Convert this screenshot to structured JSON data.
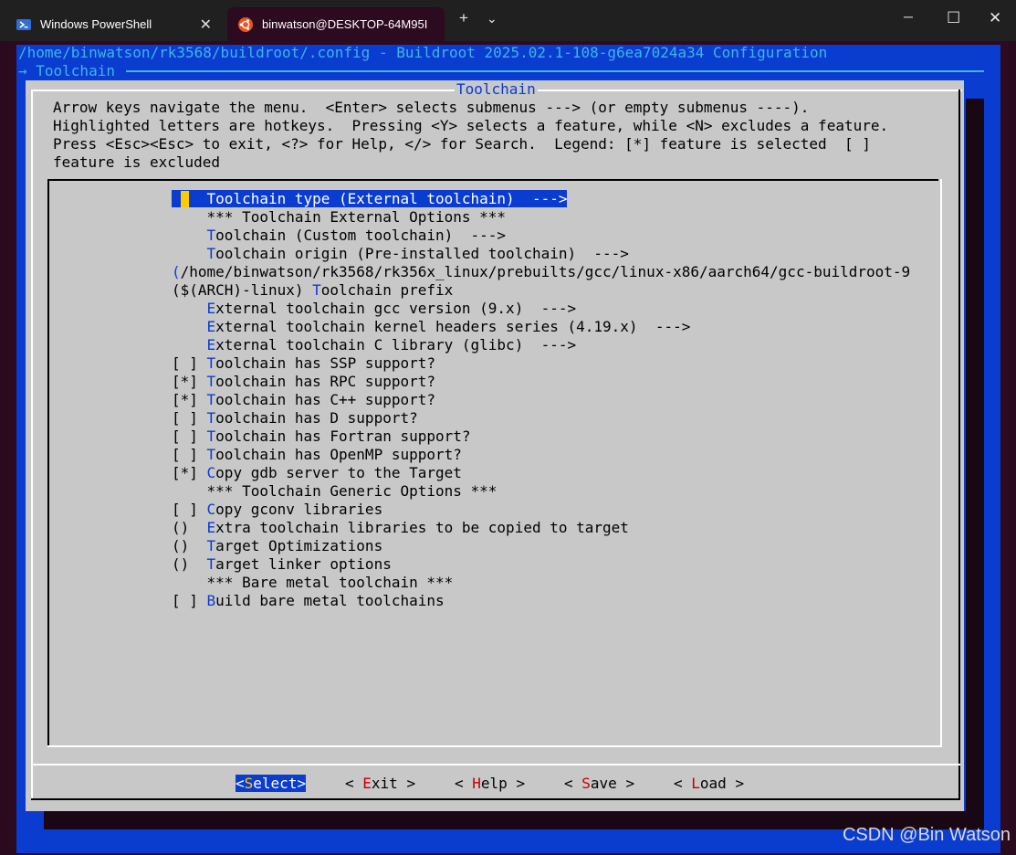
{
  "tabs": [
    {
      "label": "Windows PowerShell",
      "icon": "powershell-icon",
      "active": false
    },
    {
      "label": "binwatson@DESKTOP-64M95I",
      "icon": "ubuntu-icon",
      "active": true
    }
  ],
  "titlebar": {
    "new_tab": "+",
    "dropdown": "⌄",
    "minimize": "─",
    "maximize": "☐",
    "close": "✕",
    "tab_close": "✕"
  },
  "terminal": {
    "header": "/home/binwatson/rk3568/buildroot/.config - Buildroot 2025.02.1-108-g6ea7024a34 Configuration",
    "breadcrumb": "→ Toolchain ",
    "dialog_title": "Toolchain",
    "help_lines": [
      "Arrow keys navigate the menu.  <Enter> selects submenus ---> (or empty submenus ----).",
      "Highlighted letters are hotkeys.  Pressing <Y> selects a feature, while <N> excludes a feature.",
      "Press <Esc><Esc> to exit, <?> for Help, </> for Search.  Legend: [*] feature is selected  [ ]",
      "feature is excluded"
    ],
    "menu": [
      {
        "prefix": "    ",
        "hk": "T",
        "rest": "oolchain type (External toolchain)  --->",
        "selected": true
      },
      {
        "prefix": "    ",
        "hk": "",
        "rest": "*** Toolchain External Options ***"
      },
      {
        "prefix": "    ",
        "hk": "T",
        "rest": "oolchain (Custom toolchain)  --->"
      },
      {
        "prefix": "    ",
        "hk": "T",
        "rest": "oolchain origin (Pre-installed toolchain)  --->"
      },
      {
        "prefix": "",
        "hk": "(",
        "rest": "/home/binwatson/rk3568/rk356x_linux/prebuilts/gcc/linux-x86/aarch64/gcc-buildroot-9"
      },
      {
        "prefix": "($(ARCH)-linux) ",
        "hk": "T",
        "rest": "oolchain prefix"
      },
      {
        "prefix": "    ",
        "hk": "E",
        "rest": "xternal toolchain gcc version (9.x)  --->"
      },
      {
        "prefix": "    ",
        "hk": "E",
        "rest": "xternal toolchain kernel headers series (4.19.x)  --->"
      },
      {
        "prefix": "    ",
        "hk": "E",
        "rest": "xternal toolchain C library (glibc)  --->"
      },
      {
        "prefix": "[ ] ",
        "hk": "T",
        "rest": "oolchain has SSP support?"
      },
      {
        "prefix": "[*] ",
        "hk": "T",
        "rest": "oolchain has RPC support?"
      },
      {
        "prefix": "[*] ",
        "hk": "T",
        "rest": "oolchain has C++ support?"
      },
      {
        "prefix": "[ ] ",
        "hk": "T",
        "rest": "oolchain has D support?"
      },
      {
        "prefix": "[ ] ",
        "hk": "T",
        "rest": "oolchain has Fortran support?"
      },
      {
        "prefix": "[ ] ",
        "hk": "T",
        "rest": "oolchain has OpenMP support?"
      },
      {
        "prefix": "[*] ",
        "hk": "C",
        "rest": "opy gdb server to the Target"
      },
      {
        "prefix": "    ",
        "hk": "",
        "rest": "*** Toolchain Generic Options ***"
      },
      {
        "prefix": "[ ] ",
        "hk": "C",
        "rest": "opy gconv libraries"
      },
      {
        "prefix": "()  ",
        "hk": "E",
        "rest": "xtra toolchain libraries to be copied to target"
      },
      {
        "prefix": "()  ",
        "hk": "T",
        "rest": "arget Optimizations"
      },
      {
        "prefix": "()  ",
        "hk": "T",
        "rest": "arget linker options"
      },
      {
        "prefix": "    ",
        "hk": "",
        "rest": "*** Bare metal toolchain ***"
      },
      {
        "prefix": "[ ] ",
        "hk": "B",
        "rest": "uild bare metal toolchains"
      }
    ],
    "buttons": [
      {
        "open": "<",
        "hk": "S",
        "rest": "elect",
        "close": ">",
        "selected": true
      },
      {
        "open": "< ",
        "hk": "E",
        "rest": "xit",
        "close": " >"
      },
      {
        "open": "< ",
        "hk": "H",
        "rest": "elp",
        "close": " >"
      },
      {
        "open": "< ",
        "hk": "S",
        "rest": "ave",
        "close": " >"
      },
      {
        "open": "< ",
        "hk": "L",
        "rest": "oad",
        "close": " >"
      }
    ]
  },
  "watermark": "CSDN @Bin Watson",
  "colors": {
    "terminal_bg": "#0a3cd0",
    "dialog_bg": "#c8c8c8",
    "hotkey": "#0a3cd0",
    "button_hotkey": "#c00000",
    "header_text": "#3fb5e6",
    "cursor": "#ffcc00"
  }
}
